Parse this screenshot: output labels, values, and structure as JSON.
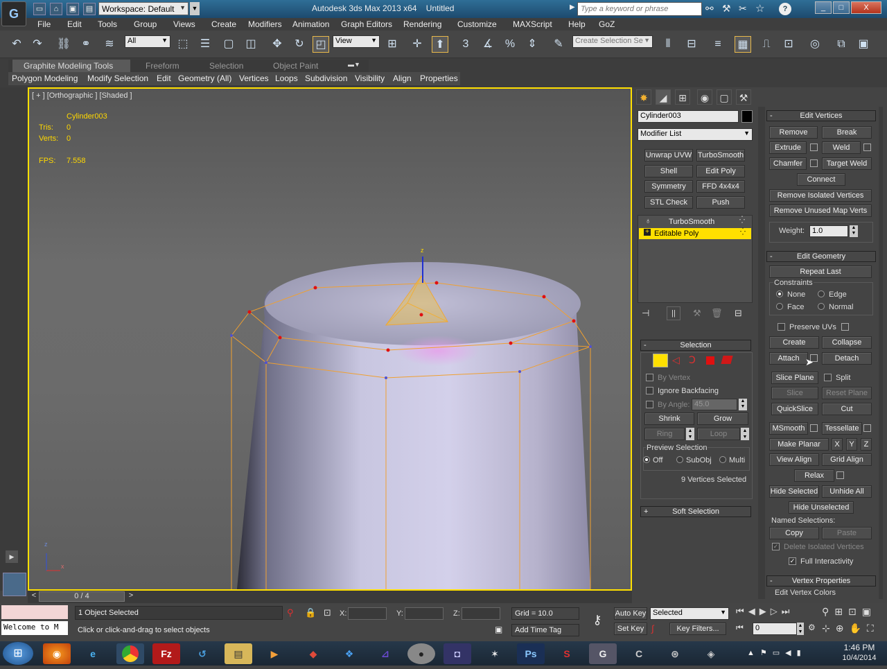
{
  "titlebar": {
    "workspace": "Workspace: Default",
    "app_title": "Autodesk 3ds Max  2013 x64",
    "file_title": "Untitled",
    "search_placeholder": "Type a keyword or phrase",
    "min": "_",
    "max": "□",
    "close": "X",
    "help": "?"
  },
  "menus": [
    "File",
    "Edit",
    "Tools",
    "Group",
    "Views",
    "Create",
    "Modifiers",
    "Animation",
    "Graph Editors",
    "Rendering",
    "Customize",
    "MAXScript",
    "Help",
    "GoZ"
  ],
  "toolbar": {
    "filter": "All",
    "ref_coord": "View",
    "selection_set_placeholder": "Create Selection Se"
  },
  "ribbon": {
    "tabs": [
      "Graphite Modeling Tools",
      "Freeform",
      "Selection",
      "Object Paint"
    ],
    "panels": [
      "Polygon Modeling",
      "Modify Selection",
      "Edit",
      "Geometry (All)",
      "Vertices",
      "Loops",
      "Subdivision",
      "Visibility",
      "Align",
      "Properties"
    ]
  },
  "viewport": {
    "label": "[ + ] [Orthographic ] [Shaded ]",
    "object": "Cylinder003",
    "tris_label": "Tris:",
    "tris": "0",
    "verts_label": "Verts:",
    "verts": "0",
    "fps_label": "FPS:",
    "fps": "7.558",
    "axis_z": "z",
    "axis_x": "x"
  },
  "command_panel": {
    "object_name": "Cylinder003",
    "modifier_list": "Modifier List",
    "modifier_buttons": [
      "Unwrap UVW",
      "TurboSmooth",
      "Shell",
      "Edit Poly",
      "Symmetry",
      "FFD 4x4x4",
      "STL Check",
      "Push"
    ],
    "stack": [
      "TurboSmooth",
      "Editable Poly"
    ],
    "selection": {
      "title": "Selection",
      "by_vertex": "By Vertex",
      "ignore_backfacing": "Ignore Backfacing",
      "by_angle": "By Angle:",
      "angle": "45.0",
      "shrink": "Shrink",
      "grow": "Grow",
      "ring": "Ring",
      "loop": "Loop",
      "preview_title": "Preview Selection",
      "off": "Off",
      "subobj": "SubObj",
      "multi": "Multi",
      "selected_info": "9 Vertices Selected"
    },
    "soft_selection": "Soft Selection",
    "edit_vertices": {
      "title": "Edit Vertices",
      "remove": "Remove",
      "break": "Break",
      "extrude": "Extrude",
      "weld": "Weld",
      "chamfer": "Chamfer",
      "target_weld": "Target Weld",
      "connect": "Connect",
      "remove_isolated": "Remove Isolated Vertices",
      "remove_unused": "Remove Unused Map Verts",
      "weight_label": "Weight:",
      "weight": "1.0"
    },
    "edit_geometry": {
      "title": "Edit Geometry",
      "repeat_last": "Repeat Last",
      "constraints": "Constraints",
      "none": "None",
      "edge": "Edge",
      "face": "Face",
      "normal": "Normal",
      "preserve_uvs": "Preserve UVs",
      "create": "Create",
      "collapse": "Collapse",
      "attach": "Attach",
      "detach": "Detach",
      "slice_plane": "Slice Plane",
      "split": "Split",
      "slice": "Slice",
      "reset_plane": "Reset Plane",
      "quickslice": "QuickSlice",
      "cut": "Cut",
      "msmooth": "MSmooth",
      "tessellate": "Tessellate",
      "make_planar": "Make Planar",
      "x": "X",
      "y": "Y",
      "z": "Z",
      "view_align": "View Align",
      "grid_align": "Grid Align",
      "relax": "Relax",
      "hide_selected": "Hide Selected",
      "unhide_all": "Unhide All",
      "hide_unselected": "Hide Unselected",
      "named_selections": "Named Selections:",
      "copy": "Copy",
      "paste": "Paste",
      "delete_isolated": "Delete Isolated Vertices",
      "full_interactivity": "Full Interactivity"
    },
    "vertex_properties": "Vertex Properties",
    "edit_vertex_colors": "Edit Vertex Colors"
  },
  "timeline": {
    "frame": "0 / 4"
  },
  "status": {
    "maxscript": "Welcome to M",
    "selected": "1 Object Selected",
    "prompt": "Click or click-and-drag to select objects",
    "x_label": "X:",
    "y_label": "Y:",
    "z_label": "Z:",
    "grid": "Grid = 10.0",
    "add_time_tag": "Add Time Tag",
    "auto_key": "Auto Key",
    "set_key": "Set Key",
    "key_mode": "Selected",
    "key_filters": "Key Filters...",
    "frame_field": "0"
  },
  "taskbar": {
    "time": "1:46 PM",
    "date": "10/4/2014"
  }
}
